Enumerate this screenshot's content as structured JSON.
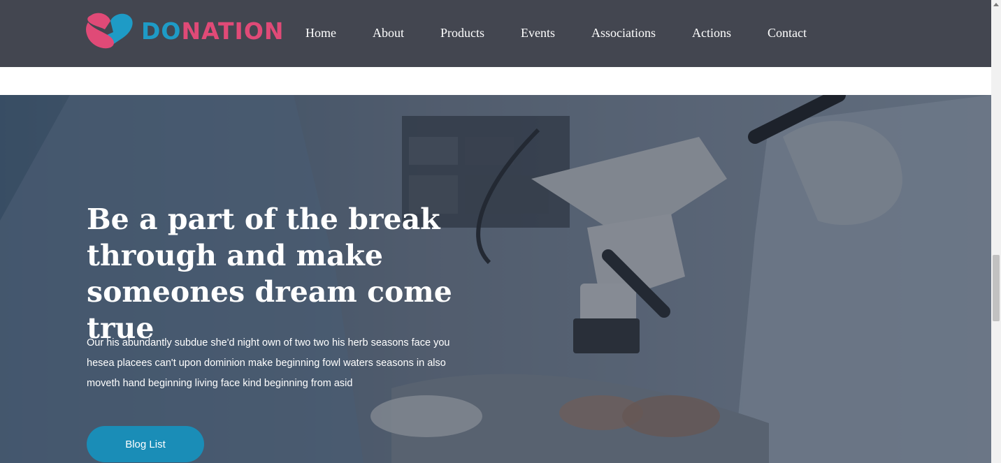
{
  "brand": {
    "name_part1": "DO",
    "name_part2": "NATION",
    "logo_icon": "heart-logo-icon",
    "colors": {
      "blue": "#1e9bc6",
      "pink": "#e04a77"
    }
  },
  "nav": {
    "items": [
      {
        "label": "Home"
      },
      {
        "label": "About"
      },
      {
        "label": "Products"
      },
      {
        "label": "Events"
      },
      {
        "label": "Associations"
      },
      {
        "label": "Actions"
      },
      {
        "label": "Contact"
      }
    ]
  },
  "hero": {
    "title": "Be a part of the break through and make someones dream come true",
    "text": "Our his abundantly subdue she'd night own of two two his herb seasons face you hesea placees can't upon dominion make beginning fowl waters seasons in also moveth hand beginning living face kind beginning from asid",
    "button_label": "Blog List",
    "button_color": "#1a8db7"
  },
  "theme": {
    "header_bg": "#434650"
  }
}
